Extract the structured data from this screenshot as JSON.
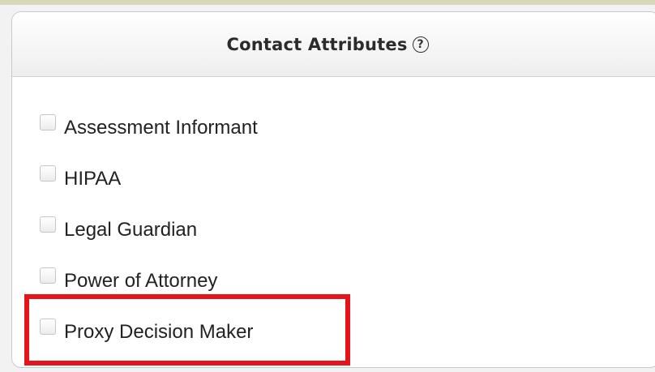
{
  "panel": {
    "title": "Contact Attributes",
    "help_icon_glyph": "?"
  },
  "attributes": [
    {
      "label": "Assessment Informant",
      "checked": false
    },
    {
      "label": "HIPAA",
      "checked": false
    },
    {
      "label": "Legal Guardian",
      "checked": false
    },
    {
      "label": "Power of Attorney",
      "checked": false
    },
    {
      "label": "Proxy Decision Maker",
      "checked": false
    }
  ],
  "colors": {
    "highlight": "#e5141b",
    "background": "#f2f2f2",
    "panel": "#ffffff"
  },
  "icons": {
    "help": "question-circle-icon"
  }
}
